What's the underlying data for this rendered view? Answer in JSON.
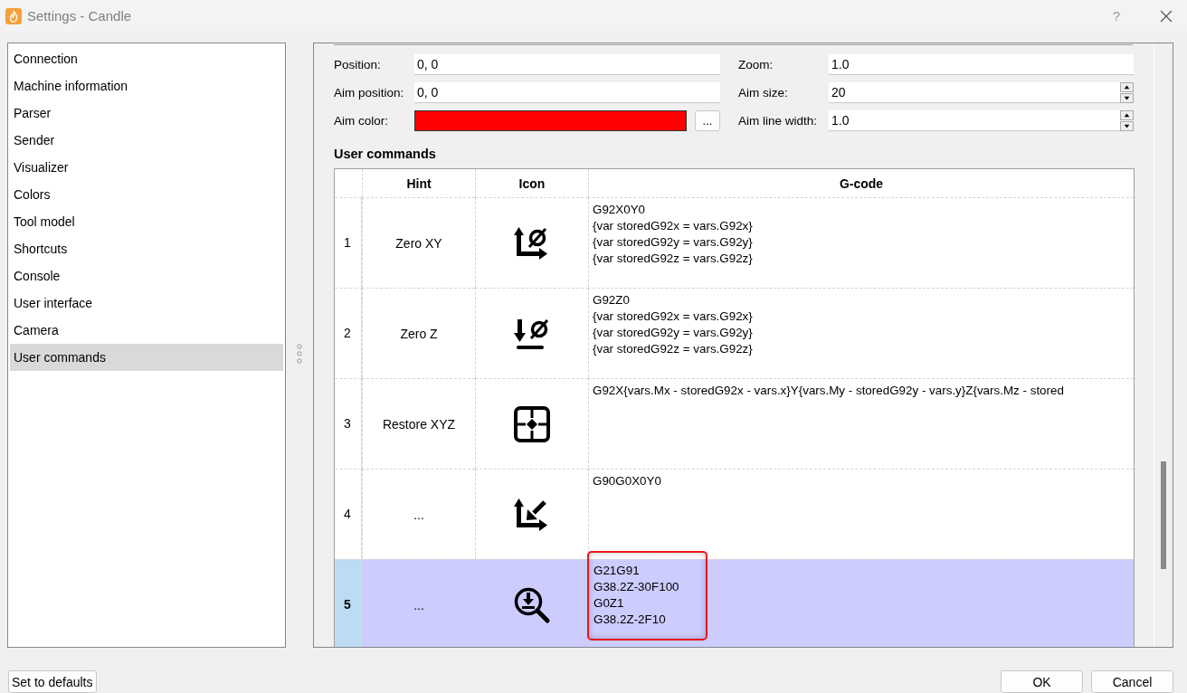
{
  "window": {
    "title": "Settings - Candle",
    "help": "?"
  },
  "sidebar": {
    "items": [
      {
        "label": "Connection",
        "selected": false
      },
      {
        "label": "Machine information",
        "selected": false
      },
      {
        "label": "Parser",
        "selected": false
      },
      {
        "label": "Sender",
        "selected": false
      },
      {
        "label": "Visualizer",
        "selected": false
      },
      {
        "label": "Colors",
        "selected": false
      },
      {
        "label": "Tool model",
        "selected": false
      },
      {
        "label": "Shortcuts",
        "selected": false
      },
      {
        "label": "Console",
        "selected": false
      },
      {
        "label": "User interface",
        "selected": false
      },
      {
        "label": "Camera",
        "selected": false
      },
      {
        "label": "User commands",
        "selected": true
      }
    ]
  },
  "view_settings": {
    "left": [
      {
        "kind": "text",
        "label": "Position:",
        "value": "0, 0"
      },
      {
        "kind": "text",
        "label": "Aim position:",
        "value": "0, 0"
      },
      {
        "kind": "color",
        "label": "Aim color:",
        "color": "#ff0000",
        "button": "..."
      }
    ],
    "right": [
      {
        "kind": "text",
        "label": "Zoom:",
        "value": "1.0"
      },
      {
        "kind": "spin",
        "label": "Aim size:",
        "value": "20"
      },
      {
        "kind": "spin",
        "label": "Aim line width:",
        "value": "1.0"
      }
    ]
  },
  "user_commands": {
    "title": "User commands",
    "columns": [
      "Hint",
      "Icon",
      "G-code"
    ],
    "rows": [
      {
        "number": "1",
        "hint": "Zero XY",
        "kind": "axes",
        "gcode": [
          "G92X0Y0",
          "{var storedG92x = vars.G92x}",
          "{var storedG92y = vars.G92y}",
          "{var storedG92z = vars.G92z}"
        ],
        "selected": false,
        "editing": false
      },
      {
        "number": "2",
        "hint": "Zero Z",
        "kind": "zaxis",
        "gcode": [
          "G92Z0",
          "{var storedG92x = vars.G92x}",
          "{var storedG92y = vars.G92y}",
          "{var storedG92z = vars.G92z}"
        ],
        "selected": false,
        "editing": false
      },
      {
        "number": "3",
        "hint": "Restore XYZ",
        "kind": "target",
        "gcode": [
          "G92X{vars.Mx - storedG92x - vars.x}Y{vars.My - storedG92y - vars.y}Z{vars.Mz - stored"
        ],
        "selected": false,
        "editing": false
      },
      {
        "number": "4",
        "hint": "...",
        "kind": "origin",
        "gcode": [
          "G90G0X0Y0"
        ],
        "selected": false,
        "editing": false
      },
      {
        "number": "5",
        "hint": "...",
        "kind": "probe",
        "gcode": [
          "G21G91",
          "G38.2Z-30F100",
          "G0Z1",
          "G38.2Z-2F10"
        ],
        "selected": true,
        "editing": true
      }
    ]
  },
  "buttons": {
    "defaults": "Set to defaults",
    "ok": "OK",
    "cancel": "Cancel"
  }
}
